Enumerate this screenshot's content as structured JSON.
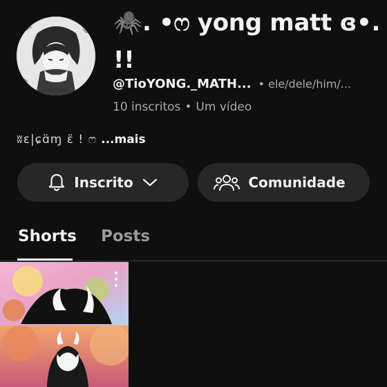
{
  "channel": {
    "name": "🕷️.  •ෆ yong matt ɞ•. !!",
    "handle": "@TioYONG._MATH...",
    "pronouns": "• ele/dele/him/...",
    "subscribers": "10 inscritos",
    "separator": "•",
    "videos": "Um vídeo",
    "bio": "ʬɛ|ɕɑ̈ɱ ɛ̈ ! ෆ",
    "more_label": "...mais"
  },
  "actions": {
    "subscribed_label": "Inscrito",
    "community_label": "Comunidade"
  },
  "tabs": [
    {
      "label": "Shorts",
      "active": true
    },
    {
      "label": "Posts",
      "active": false
    }
  ],
  "colors": {
    "background": "#0f0f0f",
    "pill": "#272727",
    "text_primary": "#f1f1f1",
    "text_secondary": "#aaaaaa"
  },
  "icons": {
    "subscribe": "bell-icon",
    "dropdown": "chevron-down-icon",
    "community": "people-icon",
    "menu": "more-vert-icon"
  }
}
